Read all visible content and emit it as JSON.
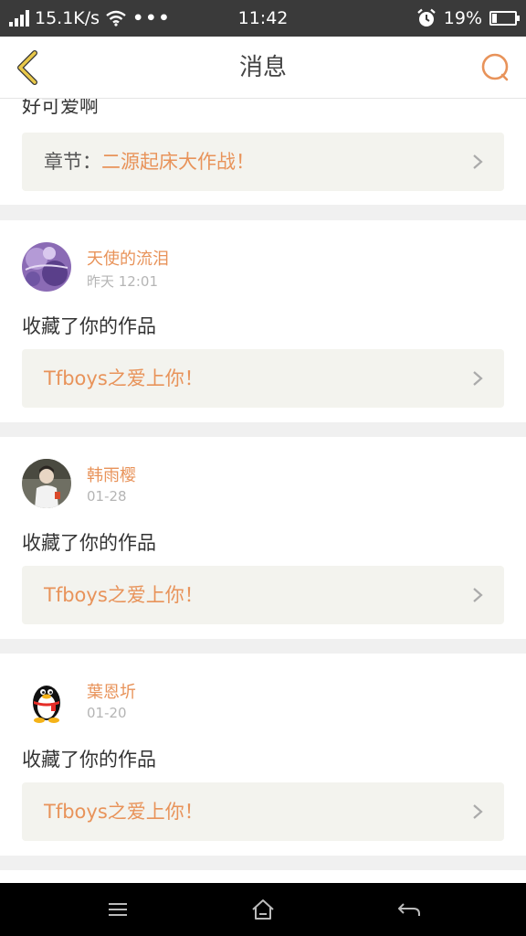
{
  "status_bar": {
    "speed": "15.1K/s",
    "overflow": "•••",
    "time": "11:42",
    "battery_percent": "19%",
    "battery_level": 0.19
  },
  "header": {
    "title": "消息"
  },
  "partial_card": {
    "text": "好可爱啊",
    "chapter_prefix": "章节：",
    "chapter_title": "二源起床大作战！"
  },
  "notifications": [
    {
      "user": "天使的流泪",
      "time": "昨天 12:01",
      "action": "收藏了你的作品",
      "work": "Tfboys之爱上你！"
    },
    {
      "user": "韩雨樱",
      "time": "01-28",
      "action": "收藏了你的作品",
      "work": "Tfboys之爱上你！"
    },
    {
      "user": "葉恩圻",
      "time": "01-20",
      "action": "收藏了你的作品",
      "work": "Tfboys之爱上你！"
    }
  ],
  "icons": {
    "back": "back-chevron-icon",
    "search": "search-icon",
    "chevron": "chevron-right-icon",
    "menu": "menu-icon",
    "home": "home-icon",
    "return": "return-icon"
  },
  "colors": {
    "accent": "#e8935a",
    "back_icon": "#e8c84a",
    "work_box_bg": "#f3f3ee"
  }
}
